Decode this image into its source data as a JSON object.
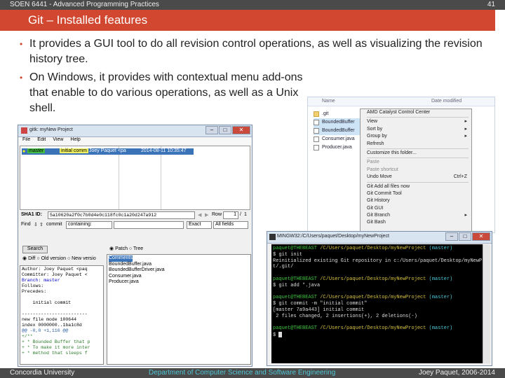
{
  "slide": {
    "course": "SOEN 6441 - Advanced Programming Practices",
    "page_number": "41",
    "title": "Git – Installed features",
    "bullets": [
      "It provides a GUI tool to do all revision control operations, as well as visualizing the revision history tree.",
      "On Windows, it provides with contextual menu add-ons that enable to do various operations, as well as a Unix shell."
    ],
    "footer": {
      "left": "Concordia University",
      "center": "Department of Computer Science and Software Engineering",
      "right": "Joey Paquet, 2006-2014"
    },
    "accent_color": "#d1472f",
    "bar_color": "#4a4a4a"
  },
  "gitk": {
    "title": "gitk: myNew Project",
    "menu": [
      "File",
      "Edit",
      "View",
      "Help"
    ],
    "branch_tag": "master",
    "commit_message": "initial comm",
    "author": "Joey Paquet <pa",
    "date": "2014-08-11 10:35:47",
    "sha_label": "SHA1 ID:",
    "sha_value": "5a10620a2f0c7b0d4e0c118fc0c1a20d247a912",
    "row_label": "Row",
    "row_value": "1",
    "row_total": "1",
    "find_label": "Find",
    "find_type": "commit",
    "find_mode": "containing:",
    "find_exact": "Exact",
    "find_fields": "All fields",
    "search_button": "Search",
    "patch_label": "Patch",
    "tree_label": "Tree",
    "diff_radio": "Diff",
    "old_version": "Old version",
    "new_version": "New versio",
    "diff_lines": [
      "Author: Joey Paquet <paq",
      "Committer: Joey Paquet <",
      "Branch: master",
      "Follows:",
      "Precedes:",
      "",
      "    initial commit",
      "",
      "------------------------",
      "new file mode 100644",
      "index 0000000..1ba1c8d",
      "@@ -0,0 +1,116 @@",
      "+/**",
      "+ * Bounded Buffer that p",
      "+ * To make it more inter",
      "+ * method that sleeps f"
    ],
    "files": [
      "Comments",
      "BoundedBuffer.java",
      "BoundedBufferDriver.java",
      "Consumer.java",
      "Producer.java"
    ]
  },
  "explorer": {
    "header_name": "Name",
    "header_date": "Date modified",
    "files": [
      ".git",
      "BoundedBuffer",
      "BoundedBuffer",
      "Consumer.java",
      "Producer.java"
    ],
    "menu": [
      {
        "label": "AMD Catalyst Control Center",
        "arrow": false,
        "shortcut": "",
        "dim": false
      },
      {
        "sep": true
      },
      {
        "label": "View",
        "arrow": true,
        "shortcut": "",
        "dim": false
      },
      {
        "label": "Sort by",
        "arrow": true,
        "shortcut": "",
        "dim": false
      },
      {
        "label": "Group by",
        "arrow": true,
        "shortcut": "",
        "dim": false
      },
      {
        "label": "Refresh",
        "arrow": false,
        "shortcut": "",
        "dim": false
      },
      {
        "sep": true
      },
      {
        "label": "Customize this folder...",
        "arrow": false,
        "shortcut": "",
        "dim": false
      },
      {
        "sep": true
      },
      {
        "label": "Paste",
        "arrow": false,
        "shortcut": "",
        "dim": true
      },
      {
        "label": "Paste shortcut",
        "arrow": false,
        "shortcut": "",
        "dim": true
      },
      {
        "label": "Undo Move",
        "arrow": false,
        "shortcut": "Ctrl+Z",
        "dim": false
      },
      {
        "sep": true
      },
      {
        "label": "Git Add all files now",
        "arrow": false,
        "shortcut": "",
        "dim": false
      },
      {
        "label": "Git Commit Tool",
        "arrow": false,
        "shortcut": "",
        "dim": false
      },
      {
        "label": "Git History",
        "arrow": false,
        "shortcut": "",
        "dim": false
      },
      {
        "label": "Git GUI",
        "arrow": false,
        "shortcut": "",
        "dim": false
      },
      {
        "label": "Git Branch",
        "arrow": true,
        "shortcut": "",
        "dim": false
      },
      {
        "label": "Git Bash",
        "arrow": false,
        "shortcut": "",
        "dim": false
      }
    ]
  },
  "terminal": {
    "title": "MINGW32:/C/Users/paquet/Desktop/myNewProject",
    "lines": [
      {
        "parts": [
          {
            "c": "g",
            "t": "paquet@THEBEAST "
          },
          {
            "c": "y",
            "t": "/C/Users/paquet/Desktop/myNewProject "
          },
          {
            "c": "c",
            "t": "(master)"
          }
        ]
      },
      {
        "parts": [
          {
            "c": "w",
            "t": "$ git init"
          }
        ]
      },
      {
        "parts": [
          {
            "c": "w",
            "t": "Reinitialized existing Git repository in c:/Users/paquet/Desktop/myNewPro"
          }
        ]
      },
      {
        "parts": [
          {
            "c": "w",
            "t": "t/.git/"
          }
        ]
      },
      {
        "parts": [
          {
            "c": "w",
            "t": ""
          }
        ]
      },
      {
        "parts": [
          {
            "c": "g",
            "t": "paquet@THEBEAST "
          },
          {
            "c": "y",
            "t": "/C/Users/paquet/Desktop/myNewProject "
          },
          {
            "c": "c",
            "t": "(master)"
          }
        ]
      },
      {
        "parts": [
          {
            "c": "w",
            "t": "$ git add *.java"
          }
        ]
      },
      {
        "parts": [
          {
            "c": "w",
            "t": ""
          }
        ]
      },
      {
        "parts": [
          {
            "c": "g",
            "t": "paquet@THEBEAST "
          },
          {
            "c": "y",
            "t": "/C/Users/paquet/Desktop/myNewProject "
          },
          {
            "c": "c",
            "t": "(master)"
          }
        ]
      },
      {
        "parts": [
          {
            "c": "w",
            "t": "$ git commit -m \"initial commit\""
          }
        ]
      },
      {
        "parts": [
          {
            "c": "w",
            "t": "[master 7a9a443] initial commit"
          }
        ]
      },
      {
        "parts": [
          {
            "c": "w",
            "t": " 2 files changed, 2 insertions(+), 2 deletions(-)"
          }
        ]
      },
      {
        "parts": [
          {
            "c": "w",
            "t": ""
          }
        ]
      },
      {
        "parts": [
          {
            "c": "g",
            "t": "paquet@THEBEAST "
          },
          {
            "c": "y",
            "t": "/C/Users/paquet/Desktop/myNewProject "
          },
          {
            "c": "c",
            "t": "(master)"
          }
        ]
      },
      {
        "parts": [
          {
            "c": "w",
            "t": "$ "
          }
        ]
      }
    ]
  }
}
